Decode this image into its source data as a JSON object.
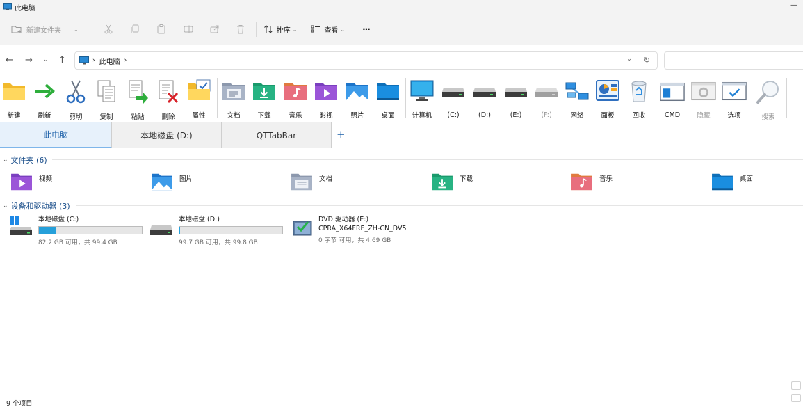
{
  "window": {
    "title": "此电脑"
  },
  "cmdbar": {
    "new_folder": "新建文件夹",
    "sort": "排序",
    "view": "查看",
    "more": "···"
  },
  "address": {
    "location": "此电脑",
    "search_placeholder": ""
  },
  "qt_toolbar": [
    {
      "label": "新建",
      "icon": "folder-icon"
    },
    {
      "label": "刷新",
      "icon": "green-arrow-icon"
    },
    {
      "label": "剪切",
      "icon": "scissors-icon"
    },
    {
      "label": "复制",
      "icon": "copy-icon"
    },
    {
      "label": "粘贴",
      "icon": "paste-icon"
    },
    {
      "label": "删除",
      "icon": "delete-icon"
    },
    {
      "label": "属性",
      "icon": "properties-icon"
    },
    {
      "label": "文档",
      "icon": "documents-folder-icon"
    },
    {
      "label": "下载",
      "icon": "downloads-folder-icon"
    },
    {
      "label": "音乐",
      "icon": "music-folder-icon"
    },
    {
      "label": "影视",
      "icon": "videos-folder-icon"
    },
    {
      "label": "照片",
      "icon": "pictures-folder-icon"
    },
    {
      "label": "桌面",
      "icon": "desktop-folder-icon"
    },
    {
      "label": "计算机",
      "icon": "monitor-icon"
    },
    {
      "label": "(C:)",
      "icon": "drive-icon"
    },
    {
      "label": "(D:)",
      "icon": "drive-icon"
    },
    {
      "label": "(E:)",
      "icon": "drive-icon"
    },
    {
      "label": "(F:)",
      "icon": "drive-icon"
    },
    {
      "label": "网络",
      "icon": "network-icon"
    },
    {
      "label": "面板",
      "icon": "control-panel-icon"
    },
    {
      "label": "回收",
      "icon": "recycle-bin-icon"
    },
    {
      "label": "CMD",
      "icon": "cmd-icon"
    },
    {
      "label": "隐藏",
      "icon": "hidden-icon"
    },
    {
      "label": "选项",
      "icon": "options-icon"
    },
    {
      "label": "搜索",
      "icon": "search-icon"
    }
  ],
  "tabs": [
    {
      "label": "此电脑",
      "active": true
    },
    {
      "label": "本地磁盘 (D:)"
    },
    {
      "label": "QTTabBar"
    }
  ],
  "tab_add": "+",
  "groups": {
    "folders": {
      "title": "文件夹 (6)"
    },
    "devices": {
      "title": "设备和驱动器 (3)"
    }
  },
  "folders": [
    {
      "name": "视频",
      "icon": "videos-folder-icon"
    },
    {
      "name": "图片",
      "icon": "pictures-folder-icon"
    },
    {
      "name": "文档",
      "icon": "documents-folder-icon"
    },
    {
      "name": "下载",
      "icon": "downloads-folder-icon"
    },
    {
      "name": "音乐",
      "icon": "music-folder-icon"
    },
    {
      "name": "桌面",
      "icon": "desktop-folder-icon"
    }
  ],
  "drives": [
    {
      "name": "本地磁盘 (C:)",
      "size": "82.2 GB 可用，共 99.4 GB",
      "used_fraction": 0.17
    },
    {
      "name": "本地磁盘 (D:)",
      "size": "99.7 GB 可用，共 99.8 GB",
      "used_fraction": 0.01
    },
    {
      "name": "DVD 驱动器 (E:)",
      "label": "CPRA_X64FRE_ZH-CN_DV5",
      "size": "0 字节 可用，共 4.69 GB"
    }
  ],
  "status": {
    "items": "9 个项目"
  },
  "colors": {
    "accent": "#26a0da",
    "tab_active": "#e7f1fb",
    "group_title": "#1a4e8a"
  }
}
